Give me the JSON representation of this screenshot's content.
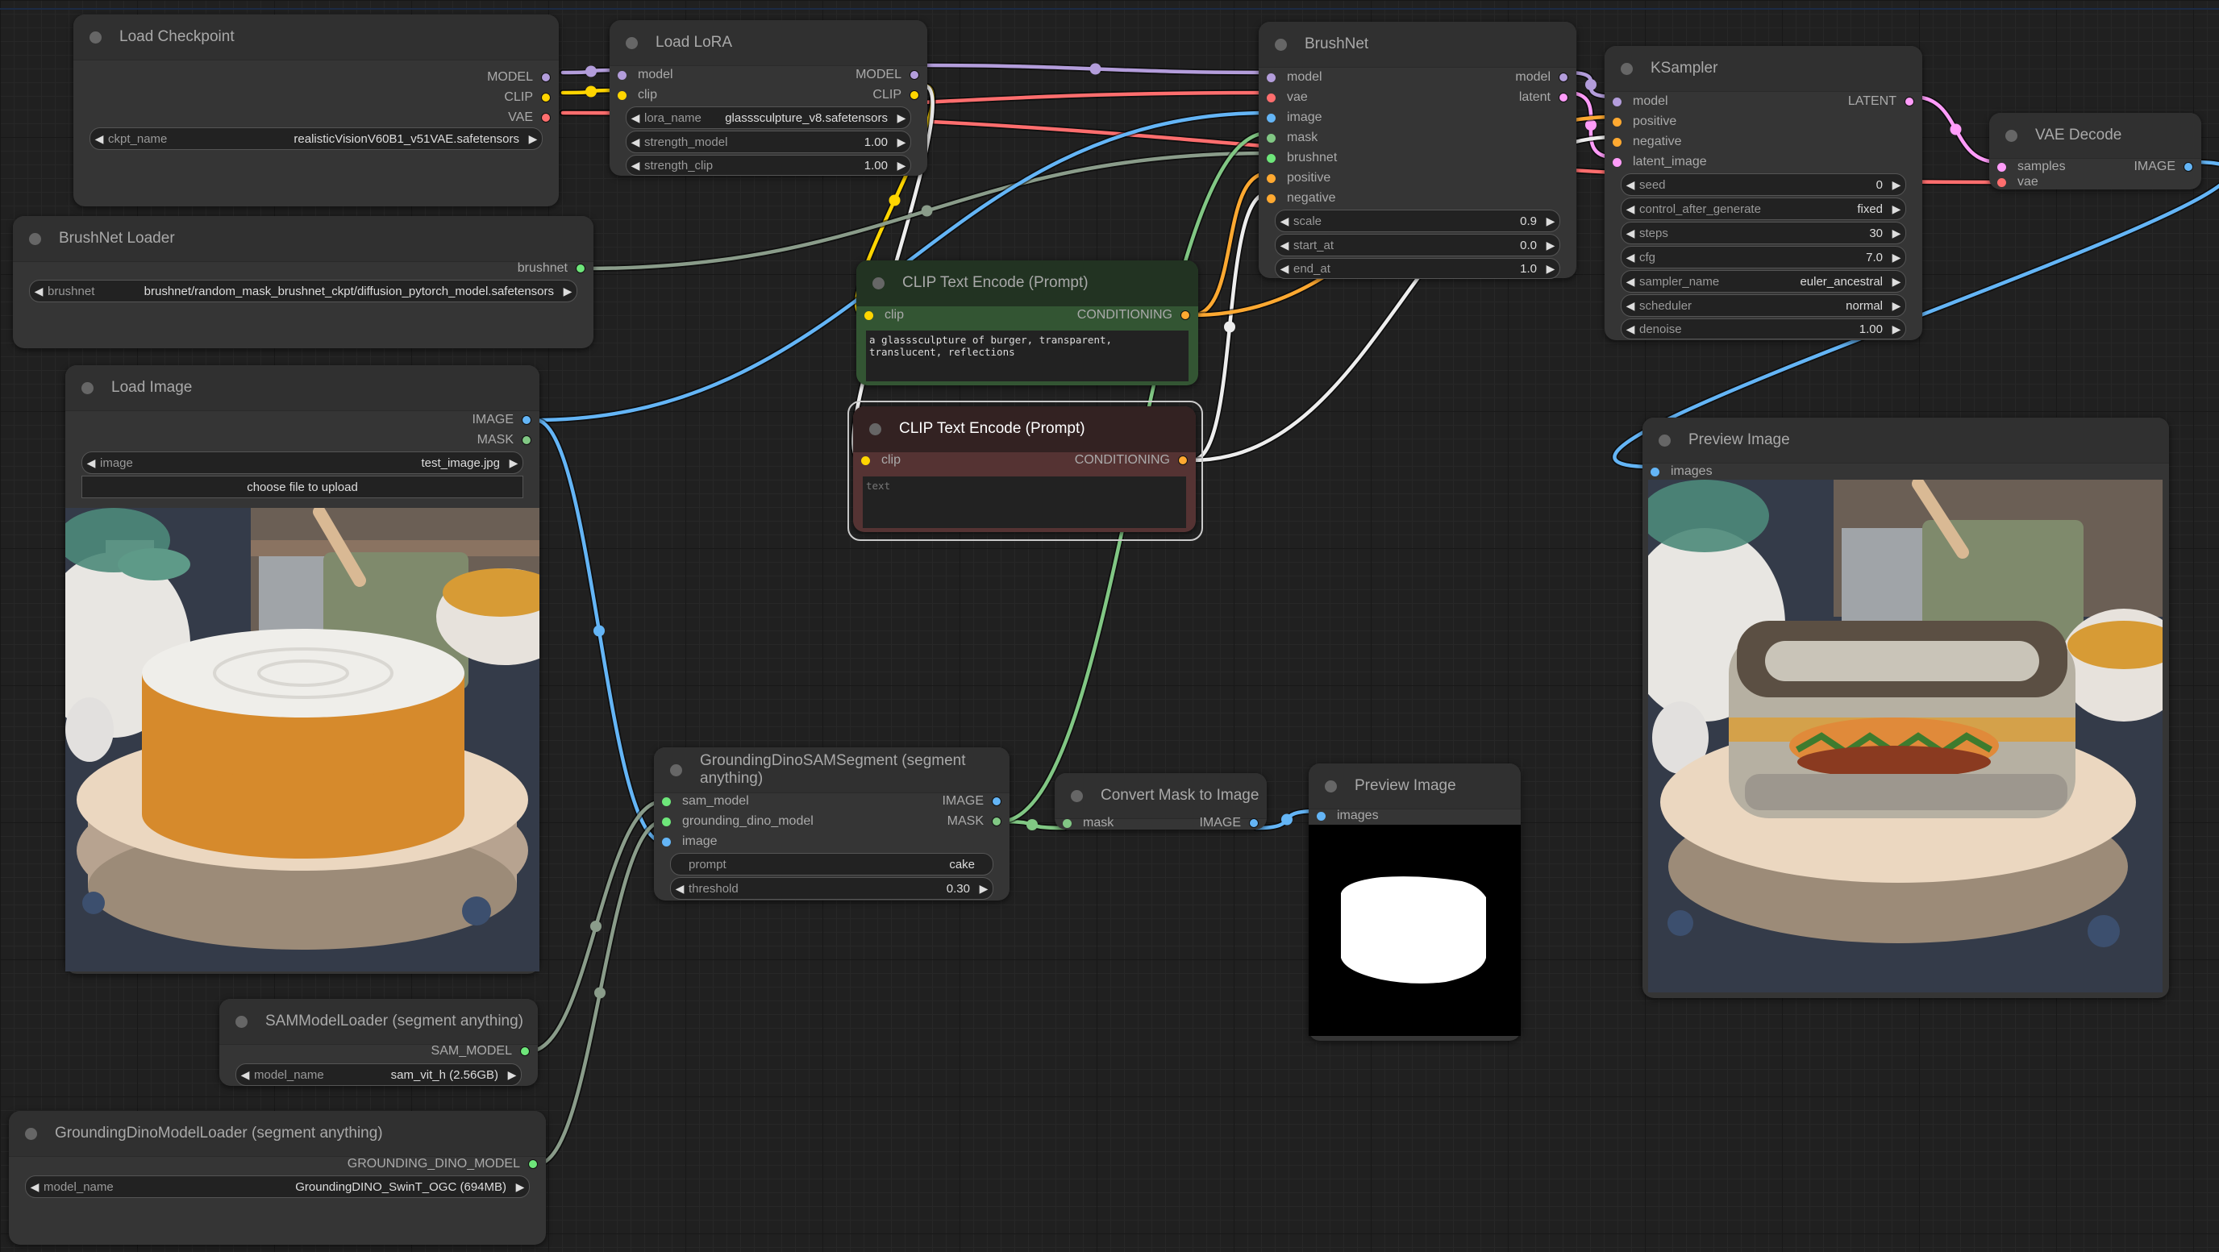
{
  "colors": {
    "model": "#b39ddb",
    "clip": "#ffd500",
    "vae": "#ff6e6e",
    "image": "#64b5f6",
    "mask": "#81c784",
    "brushnet": "#6ee67a",
    "conditioning": "#ffa931",
    "latent": "#ff9cf9",
    "sam": "#6ee67a",
    "gray_link": "#8a9c8a",
    "white_link": "#eeeeee"
  },
  "nodes": {
    "load_checkpoint": {
      "title": "Load Checkpoint",
      "outputs": [
        "MODEL",
        "CLIP",
        "VAE"
      ],
      "widgets": [
        {
          "name": "ckpt_name",
          "value": "realisticVisionV60B1_v51VAE.safetensors"
        }
      ]
    },
    "load_lora": {
      "title": "Load LoRA",
      "inputs": [
        "model",
        "clip"
      ],
      "outputs": [
        "MODEL",
        "CLIP"
      ],
      "widgets": [
        {
          "name": "lora_name",
          "value": "glasssculpture_v8.safetensors"
        },
        {
          "name": "strength_model",
          "value": "1.00"
        },
        {
          "name": "strength_clip",
          "value": "1.00"
        }
      ]
    },
    "brushnet": {
      "title": "BrushNet",
      "inputs": [
        "model",
        "vae",
        "image",
        "mask",
        "brushnet",
        "positive",
        "negative"
      ],
      "outputs": [
        "model",
        "latent"
      ],
      "widgets": [
        {
          "name": "scale",
          "value": "0.9"
        },
        {
          "name": "start_at",
          "value": "0.0"
        },
        {
          "name": "end_at",
          "value": "1.0"
        }
      ]
    },
    "ksampler": {
      "title": "KSampler",
      "inputs": [
        "model",
        "positive",
        "negative",
        "latent_image"
      ],
      "outputs": [
        "LATENT"
      ],
      "widgets": [
        {
          "name": "seed",
          "value": "0"
        },
        {
          "name": "control_after_generate",
          "value": "fixed"
        },
        {
          "name": "steps",
          "value": "30"
        },
        {
          "name": "cfg",
          "value": "7.0"
        },
        {
          "name": "sampler_name",
          "value": "euler_ancestral"
        },
        {
          "name": "scheduler",
          "value": "normal"
        },
        {
          "name": "denoise",
          "value": "1.00"
        }
      ]
    },
    "vae_decode": {
      "title": "VAE Decode",
      "inputs": [
        "samples",
        "vae"
      ],
      "outputs": [
        "IMAGE"
      ]
    },
    "brushnet_loader": {
      "title": "BrushNet Loader",
      "outputs": [
        "brushnet"
      ],
      "widgets": [
        {
          "name": "brushnet",
          "value": "brushnet/random_mask_brushnet_ckpt/diffusion_pytorch_model.safetensors"
        }
      ]
    },
    "clip_positive": {
      "title": "CLIP Text Encode (Prompt)",
      "inputs": [
        "clip"
      ],
      "outputs": [
        "CONDITIONING"
      ],
      "text": "a glasssculpture of burger, transparent,\ntranslucent, reflections"
    },
    "clip_negative": {
      "title": "CLIP Text Encode (Prompt)",
      "inputs": [
        "clip"
      ],
      "outputs": [
        "CONDITIONING"
      ],
      "text": "",
      "placeholder": "text"
    },
    "load_image": {
      "title": "Load Image",
      "outputs": [
        "IMAGE",
        "MASK"
      ],
      "widgets": [
        {
          "name": "image",
          "value": "test_image.jpg"
        }
      ],
      "upload_label": "choose file to upload"
    },
    "preview_result": {
      "title": "Preview Image",
      "inputs": [
        "images"
      ]
    },
    "grounding_sam_segment": {
      "title": "GroundingDinoSAMSegment (segment anything)",
      "inputs": [
        "sam_model",
        "grounding_dino_model",
        "image"
      ],
      "outputs": [
        "IMAGE",
        "MASK"
      ],
      "widgets": [
        {
          "name": "prompt",
          "value": "cake"
        },
        {
          "name": "threshold",
          "value": "0.30"
        }
      ]
    },
    "convert_mask": {
      "title": "Convert Mask to Image",
      "inputs": [
        "mask"
      ],
      "outputs": [
        "IMAGE"
      ]
    },
    "preview_mask": {
      "title": "Preview Image",
      "inputs": [
        "images"
      ]
    },
    "sam_loader": {
      "title": "SAMModelLoader (segment anything)",
      "outputs": [
        "SAM_MODEL"
      ],
      "widgets": [
        {
          "name": "model_name",
          "value": "sam_vit_h (2.56GB)"
        }
      ]
    },
    "grounding_dino_loader": {
      "title": "GroundingDinoModelLoader (segment anything)",
      "outputs": [
        "GROUNDING_DINO_MODEL"
      ],
      "widgets": [
        {
          "name": "model_name",
          "value": "GroundingDINO_SwinT_OGC (694MB)"
        }
      ]
    }
  }
}
